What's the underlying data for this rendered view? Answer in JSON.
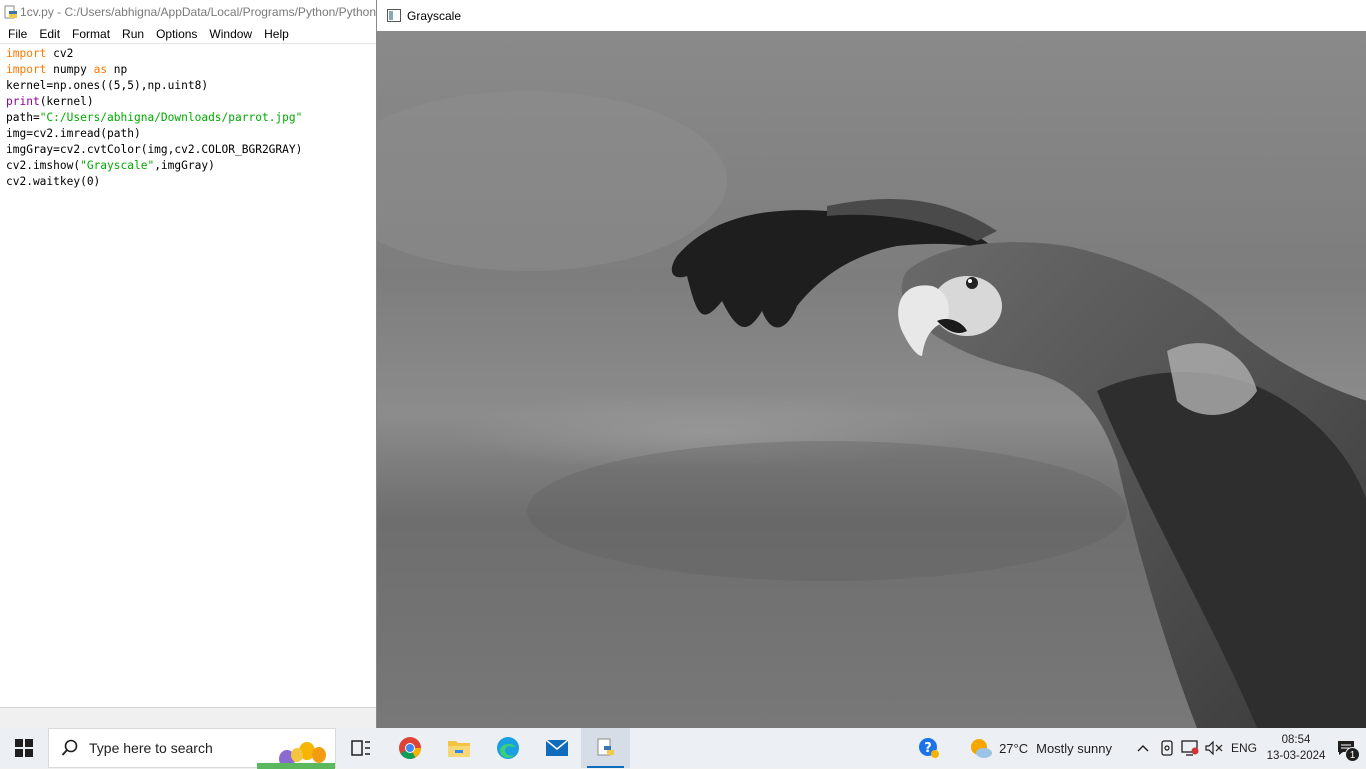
{
  "idle": {
    "title": "1cv.py - C:/Users/abhigna/AppData/Local/Programs/Python/Python",
    "menu": [
      "File",
      "Edit",
      "Format",
      "Run",
      "Options",
      "Window",
      "Help"
    ],
    "code": {
      "l1_kw": "import",
      "l1_rest": " cv2",
      "l2_kw": "import",
      "l2_mid": " numpy ",
      "l2_kw2": "as",
      "l2_rest": " np",
      "l3": "kernel=np.ones((5,5),np.uint8)",
      "l4_bi": "print",
      "l4_rest": "(kernel)",
      "l5_a": "path=",
      "l5_str": "\"C:/Users/abhigna/Downloads/parrot.jpg\"",
      "l6": "img=cv2.imread(path)",
      "l7": "imgGray=cv2.cvtColor(img,cv2.COLOR_BGR2GRAY)",
      "l8_a": "cv2.imshow(",
      "l8_str": "\"Grayscale\"",
      "l8_b": ",imgGray)",
      "l9": "cv2.waitkey(0)"
    }
  },
  "image_window": {
    "title": "Grayscale"
  },
  "taskbar": {
    "search_placeholder": "Type here to search",
    "weather_temp": "27°C",
    "weather_text": "Mostly sunny",
    "language": "ENG",
    "time": "08:54",
    "date": "13-03-2024",
    "notification_count": "1",
    "apps": [
      "task-view-icon",
      "chrome-icon",
      "file-explorer-icon",
      "edge-icon",
      "mail-icon",
      "python-idle-icon"
    ]
  },
  "colors": {
    "keyword": "#ff7700",
    "builtin": "#900090",
    "string": "#00aa00",
    "taskbar_bg": "#ecf0f4"
  }
}
